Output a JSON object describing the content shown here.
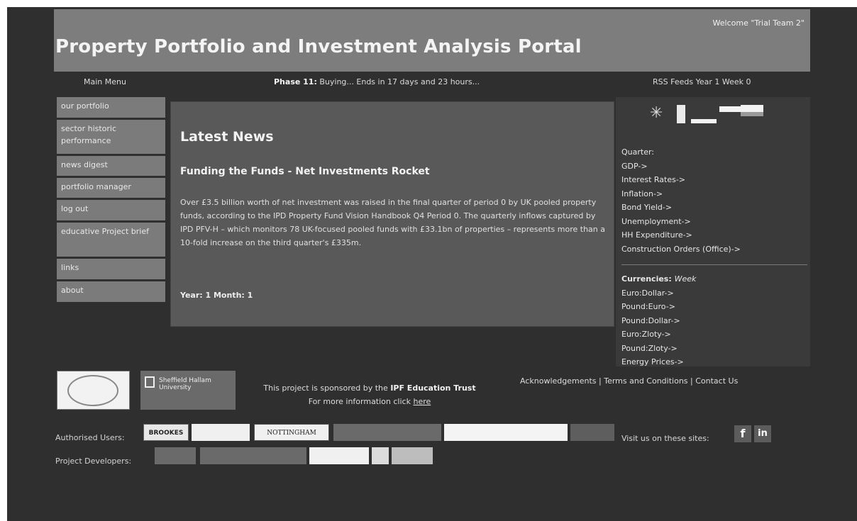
{
  "header": {
    "title": "Property Portfolio and Investment Analysis Portal",
    "welcome": "Welcome \"Trial Team 2\""
  },
  "topbar": {
    "menu_title": "Main Menu",
    "phase_label": "Phase 11:",
    "phase_text": "Buying... Ends in 17 days and 23 hours...",
    "rss": "RSS Feeds Year 1 Week 0"
  },
  "menu": {
    "items": [
      {
        "label": "our portfolio"
      },
      {
        "label": "sector historic performance"
      },
      {
        "label": "news digest"
      },
      {
        "label": "portfolio manager"
      },
      {
        "label": "log out"
      },
      {
        "label": "educative Project brief"
      },
      {
        "label": "links"
      },
      {
        "label": "about"
      }
    ]
  },
  "news": {
    "heading": "Latest News",
    "headline": "Funding the Funds - Net Investments Rocket",
    "body": "Over £3.5 billion worth of net investment was raised in the final quarter of period 0 by UK pooled property funds, according to the IPD Property Fund Vision Handbook Q4 Period 0. The quarterly inflows captured by IPD PFV-H – which monitors 78 UK-focused pooled funds with £33.1bn of properties – represents more than a 10-fold increase on the third quarter's £335m.",
    "date": "Year: 1 Month: 1"
  },
  "right": {
    "quarter_items": [
      "Quarter:",
      "GDP->",
      "Interest Rates->",
      "Inflation->",
      "Bond Yield->",
      "Unemployment->",
      "HH Expenditure->",
      "Construction Orders (Office)->"
    ],
    "currencies_label": "Currencies:",
    "currencies_period": "Week",
    "currency_items": [
      "Euro:Dollar->",
      "Pound:Euro->",
      "Pound:Dollar->",
      "Euro:Zloty->",
      "Pound:Zloty->",
      "Energy Prices->"
    ]
  },
  "footer": {
    "sponsor_text": "This project is sponsored by the",
    "sponsor_org": "IPF Education Trust",
    "more_info": "For more information click",
    "here": "here",
    "links": [
      "Acknowledgements",
      "Terms and Conditions",
      "Contact Us"
    ],
    "authorised_label": "Authorised Users:",
    "developers_label": "Project Developers:",
    "visit": "Visit us on these sites:",
    "logo_text": "Sheffield Hallam University"
  },
  "colors": {
    "background": "#2f2f2f",
    "header": "#7d7d7d",
    "menu_item": "#7b7b7b",
    "news_panel": "#595959"
  }
}
